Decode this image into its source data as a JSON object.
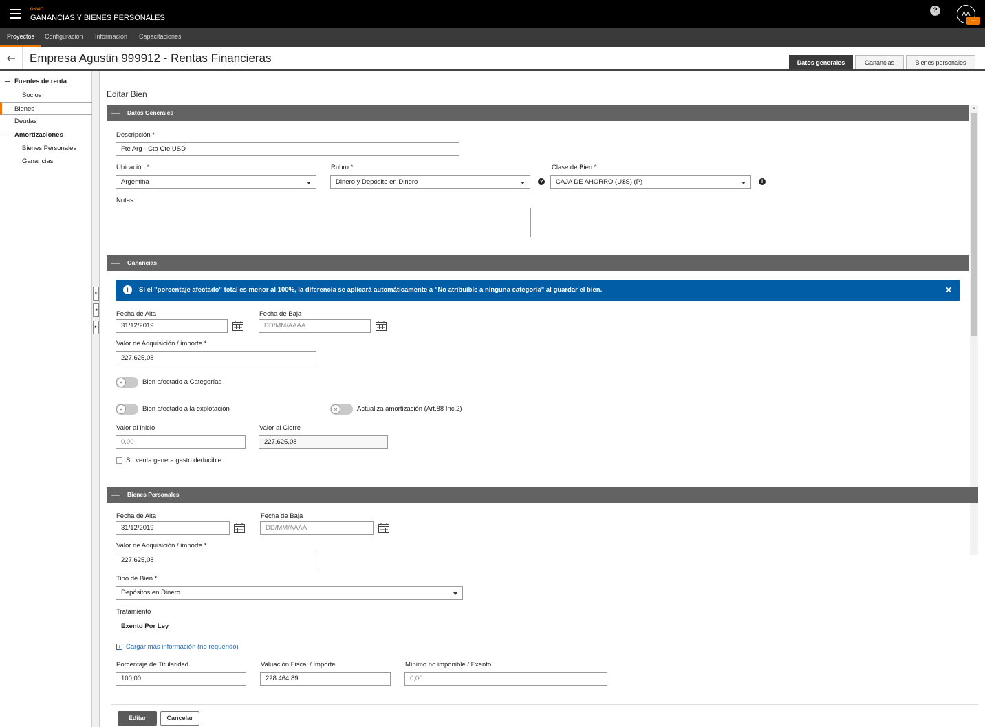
{
  "header": {
    "brand_small": "ONVIO",
    "app_title": "GANANCIAS Y BIENES PERSONALES",
    "help_glyph": "?",
    "avatar_initials": "AA",
    "avatar_badge": "...",
    "menu_icon": "hamburger-icon"
  },
  "menu": {
    "items": [
      "Proyectos",
      "Configuración",
      "Información",
      "Capacitaciones"
    ],
    "active": "Proyectos"
  },
  "page": {
    "back_icon": "arrow-left-icon",
    "title": "Empresa Agustin 999912 - Rentas Financieras",
    "tabs": [
      "Datos generales",
      "Ganancias",
      "Bienes personales"
    ],
    "active_tab": "Datos generales"
  },
  "sidebar": {
    "items": [
      {
        "label": "Fuentes de renta",
        "level": 0
      },
      {
        "label": "Socios",
        "level": 1
      },
      {
        "label": "Bienes",
        "level": 0,
        "selected": true
      },
      {
        "label": "Deudas",
        "level": 0
      },
      {
        "label": "Amortizaciones",
        "level": 0
      },
      {
        "label": "Bienes Personales",
        "level": 1
      },
      {
        "label": "Ganancias",
        "level": 1
      }
    ]
  },
  "form": {
    "heading": "Editar Bien",
    "datos_generales": {
      "section_title": "Datos Generales",
      "descripcion_label": "Descripción *",
      "descripcion_value": "Fte Arg - Cta Cte USD",
      "ubicacion_label": "Ubicación *",
      "ubicacion_value": "Argentina",
      "rubro_label": "Rubro *",
      "rubro_value": "Dinero y Depósito en Dinero",
      "clase_label": "Clase de Bien *",
      "clase_value": "CAJA DE AHORRO (U$S)   (P)",
      "notas_label": "Notas",
      "notas_value": ""
    },
    "ganancias": {
      "section_title": "Ganancias",
      "alert_text": "Si el \"porcentaje afectado\" total es menor al 100%, la diferencia se aplicará automáticamente a \"No atribuible a ninguna categoría\" al guardar el bien.",
      "alert_close": "×",
      "fecha_alta_label": "Fecha de Alta",
      "fecha_alta_value": "31/12/2019",
      "fecha_baja_label": "Fecha de Baja",
      "fecha_baja_placeholder": "DD/MM/AAAA",
      "valor_adq_label": "Valor de Adquisición / importe *",
      "valor_adq_value": "227.625,08",
      "toggle_categorias": "Bien afectado a Categorías",
      "toggle_explotacion": "Bien afectado a la explotación",
      "toggle_amortizacion": "Actualiza amortización (Art.88 Inc.2)",
      "valor_inicio_label": "Valor al Inicio",
      "valor_inicio_value": "0,00",
      "valor_cierre_label": "Valor al Cierre",
      "valor_cierre_value": "227.625,08",
      "venta_checkbox": "Su venta genera gasto deducible"
    },
    "bienes_personales": {
      "section_title": "Bienes Personales",
      "fecha_alta_label": "Fecha de Alta",
      "fecha_alta_value": "31/12/2019",
      "fecha_baja_label": "Fecha de Baja",
      "fecha_baja_placeholder": "DD/MM/AAAA",
      "valor_adq_label": "Valor de Adquisición / importe *",
      "valor_adq_value": "227.625,08",
      "tipo_label": "Tipo de Bien *",
      "tipo_value": "Depósitos en Dinero",
      "tratamiento_label": "Tratamiento",
      "tratamiento_value": "Exento Por Ley",
      "mas_info": "Cargar más información (no requerido)",
      "porcentaje_label": "Porcentaje de Titularidad",
      "porcentaje_value": "100,00",
      "valuacion_label": "Valuación Fiscal / Importe",
      "valuacion_value": "228.464,89",
      "minimo_label": "Mínimo no imponible / Exento",
      "minimo_value": "0,00"
    },
    "buttons": {
      "edit": "Editar",
      "cancel": "Cancelar"
    }
  },
  "colors": {
    "accent": "#f07800",
    "alert_bg": "#005da6",
    "section_bar": "#636363",
    "topbar": "#000000"
  }
}
